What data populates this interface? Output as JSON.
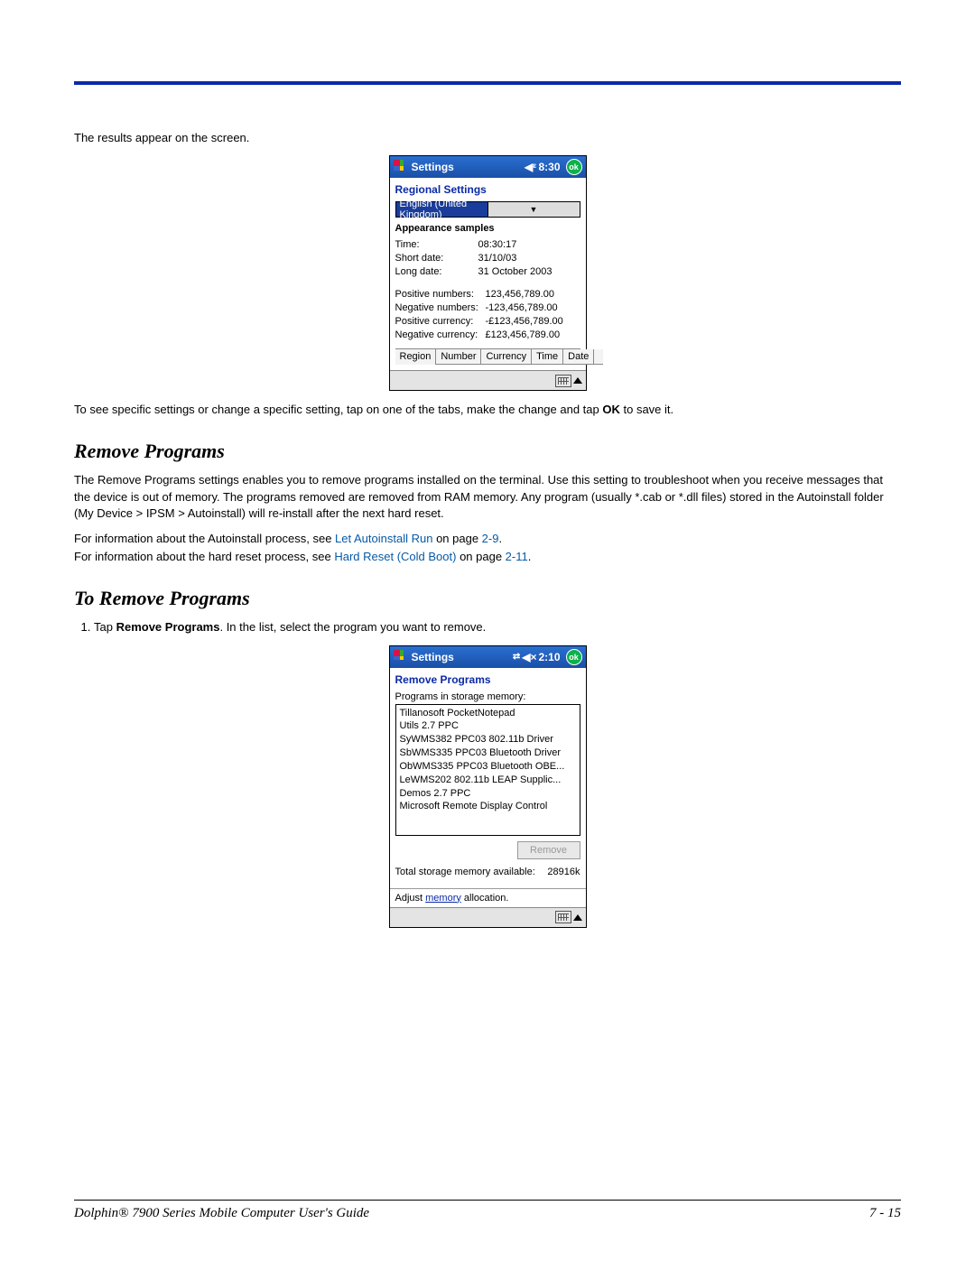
{
  "intro": "The results appear on the screen.",
  "pda1": {
    "title": "Settings",
    "time": "8:30",
    "ok": "ok",
    "heading": "Regional Settings",
    "dropdown": "English (United Kingdom)",
    "samples_heading": "Appearance samples",
    "rows": [
      {
        "l": "Time:",
        "v": "08:30:17"
      },
      {
        "l": "Short date:",
        "v": "31/10/03"
      },
      {
        "l": "Long date:",
        "v": "31 October 2003"
      }
    ],
    "rows2": [
      {
        "l": "Positive numbers:",
        "v": "123,456,789.00"
      },
      {
        "l": "Negative numbers:",
        "v": "-123,456,789.00"
      },
      {
        "l": "Positive currency:",
        "v": "-£123,456,789.00"
      },
      {
        "l": "Negative currency:",
        "v": "£123,456,789.00"
      }
    ],
    "tabs": [
      "Region",
      "Number",
      "Currency",
      "Time",
      "Date"
    ]
  },
  "para2a": "To see specific settings or change a specific setting, tap on one of the tabs, make the change and tap ",
  "para2b": "OK",
  "para2c": " to save it.",
  "h_remove": "Remove Programs",
  "para3": "The Remove Programs settings enables you to remove programs installed on the terminal. Use this setting to troubleshoot when you receive messages that the device is out of memory. The programs removed are removed from RAM memory. Any program (usually *.cab or *.dll files) stored in the Autoinstall folder (My Device > IPSM > Autoinstall) will re-install after the next hard reset.",
  "para4a": "For information about the Autoinstall process, see ",
  "para4link": "Let Autoinstall Run",
  "para4b": " on page ",
  "para4page": "2-9",
  "para4c": ".",
  "para5a": "For information about the hard reset process, see ",
  "para5link": "Hard Reset (Cold Boot)",
  "para5b": " on page ",
  "para5page": "2-11",
  "para5c": ".",
  "h_toremove": "To Remove Programs",
  "step1a": "Tap ",
  "step1b": "Remove Programs",
  "step1c": ". In the list, select the program you want to remove.",
  "pda2": {
    "title": "Settings",
    "time": "2:10",
    "ok": "ok",
    "heading": "Remove Programs",
    "label": "Programs in storage memory:",
    "items": [
      "Tillanosoft PocketNotepad",
      "Utils 2.7 PPC",
      "SyWMS382 PPC03 802.11b Driver",
      "SbWMS335 PPC03 Bluetooth Driver",
      "ObWMS335 PPC03 Bluetooth OBE...",
      "LeWMS202 802.11b LEAP Supplic...",
      "Demos 2.7 PPC",
      "Microsoft Remote Display Control"
    ],
    "remove_btn": "Remove",
    "avail_label": "Total storage memory available:",
    "avail_val": "28916k",
    "adjust_a": "Adjust ",
    "adjust_link": "memory",
    "adjust_b": " allocation."
  },
  "footer_left": "Dolphin® 7900 Series Mobile Computer User's Guide",
  "footer_right": "7 - 15"
}
